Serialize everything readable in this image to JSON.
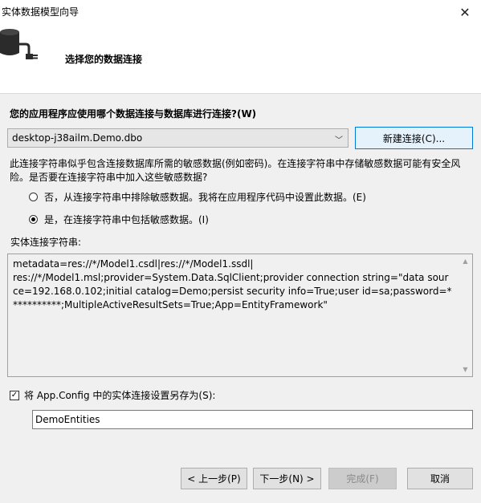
{
  "window": {
    "title": "实体数据模型向导",
    "close_glyph": "✕"
  },
  "header": {
    "title": "选择您的数据连接",
    "icon": "database-plug-icon"
  },
  "connection": {
    "question": "您的应用程序应使用哪个数据连接与数据库进行连接?(W)",
    "selected": "desktop-j38ailm.Demo.dbo",
    "new_connection_label": "新建连接(C)..."
  },
  "sensitive": {
    "warning": "此连接字符串似乎包含连接数据库所需的敏感数据(例如密码)。在连接字符串中存储敏感数据可能有安全风险。是否要在连接字符串中加入这些敏感数据?",
    "option_no": "否，从连接字符串中排除敏感数据。我将在应用程序代码中设置此数据。(E)",
    "option_yes": "是，在连接字符串中包括敏感数据。(I)",
    "selected": "yes"
  },
  "connection_string": {
    "label": "实体连接字符串:",
    "value": "metadata=res://*/Model1.csdl|res://*/Model1.ssdl|\nres://*/Model1.msl;provider=System.Data.SqlClient;provider connection string=\"data source=192.168.0.102;initial catalog=Demo;persist security info=True;user id=sa;password=***********;MultipleActiveResultSets=True;App=EntityFramework\""
  },
  "save_config": {
    "label": "将 App.Config 中的实体连接设置另存为(S):",
    "checked": true,
    "value": "DemoEntities"
  },
  "buttons": {
    "prev": "< 上一步(P)",
    "next": "下一步(N) >",
    "finish": "完成(F)",
    "cancel": "取消"
  }
}
